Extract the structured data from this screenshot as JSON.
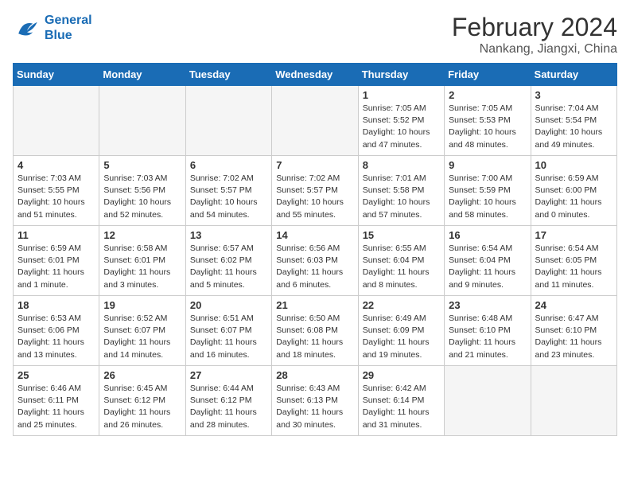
{
  "logo": {
    "line1": "General",
    "line2": "Blue"
  },
  "title": "February 2024",
  "location": "Nankang, Jiangxi, China",
  "weekdays": [
    "Sunday",
    "Monday",
    "Tuesday",
    "Wednesday",
    "Thursday",
    "Friday",
    "Saturday"
  ],
  "weeks": [
    [
      {
        "day": "",
        "info": ""
      },
      {
        "day": "",
        "info": ""
      },
      {
        "day": "",
        "info": ""
      },
      {
        "day": "",
        "info": ""
      },
      {
        "day": "1",
        "info": "Sunrise: 7:05 AM\nSunset: 5:52 PM\nDaylight: 10 hours\nand 47 minutes."
      },
      {
        "day": "2",
        "info": "Sunrise: 7:05 AM\nSunset: 5:53 PM\nDaylight: 10 hours\nand 48 minutes."
      },
      {
        "day": "3",
        "info": "Sunrise: 7:04 AM\nSunset: 5:54 PM\nDaylight: 10 hours\nand 49 minutes."
      }
    ],
    [
      {
        "day": "4",
        "info": "Sunrise: 7:03 AM\nSunset: 5:55 PM\nDaylight: 10 hours\nand 51 minutes."
      },
      {
        "day": "5",
        "info": "Sunrise: 7:03 AM\nSunset: 5:56 PM\nDaylight: 10 hours\nand 52 minutes."
      },
      {
        "day": "6",
        "info": "Sunrise: 7:02 AM\nSunset: 5:57 PM\nDaylight: 10 hours\nand 54 minutes."
      },
      {
        "day": "7",
        "info": "Sunrise: 7:02 AM\nSunset: 5:57 PM\nDaylight: 10 hours\nand 55 minutes."
      },
      {
        "day": "8",
        "info": "Sunrise: 7:01 AM\nSunset: 5:58 PM\nDaylight: 10 hours\nand 57 minutes."
      },
      {
        "day": "9",
        "info": "Sunrise: 7:00 AM\nSunset: 5:59 PM\nDaylight: 10 hours\nand 58 minutes."
      },
      {
        "day": "10",
        "info": "Sunrise: 6:59 AM\nSunset: 6:00 PM\nDaylight: 11 hours\nand 0 minutes."
      }
    ],
    [
      {
        "day": "11",
        "info": "Sunrise: 6:59 AM\nSunset: 6:01 PM\nDaylight: 11 hours\nand 1 minute."
      },
      {
        "day": "12",
        "info": "Sunrise: 6:58 AM\nSunset: 6:01 PM\nDaylight: 11 hours\nand 3 minutes."
      },
      {
        "day": "13",
        "info": "Sunrise: 6:57 AM\nSunset: 6:02 PM\nDaylight: 11 hours\nand 5 minutes."
      },
      {
        "day": "14",
        "info": "Sunrise: 6:56 AM\nSunset: 6:03 PM\nDaylight: 11 hours\nand 6 minutes."
      },
      {
        "day": "15",
        "info": "Sunrise: 6:55 AM\nSunset: 6:04 PM\nDaylight: 11 hours\nand 8 minutes."
      },
      {
        "day": "16",
        "info": "Sunrise: 6:54 AM\nSunset: 6:04 PM\nDaylight: 11 hours\nand 9 minutes."
      },
      {
        "day": "17",
        "info": "Sunrise: 6:54 AM\nSunset: 6:05 PM\nDaylight: 11 hours\nand 11 minutes."
      }
    ],
    [
      {
        "day": "18",
        "info": "Sunrise: 6:53 AM\nSunset: 6:06 PM\nDaylight: 11 hours\nand 13 minutes."
      },
      {
        "day": "19",
        "info": "Sunrise: 6:52 AM\nSunset: 6:07 PM\nDaylight: 11 hours\nand 14 minutes."
      },
      {
        "day": "20",
        "info": "Sunrise: 6:51 AM\nSunset: 6:07 PM\nDaylight: 11 hours\nand 16 minutes."
      },
      {
        "day": "21",
        "info": "Sunrise: 6:50 AM\nSunset: 6:08 PM\nDaylight: 11 hours\nand 18 minutes."
      },
      {
        "day": "22",
        "info": "Sunrise: 6:49 AM\nSunset: 6:09 PM\nDaylight: 11 hours\nand 19 minutes."
      },
      {
        "day": "23",
        "info": "Sunrise: 6:48 AM\nSunset: 6:10 PM\nDaylight: 11 hours\nand 21 minutes."
      },
      {
        "day": "24",
        "info": "Sunrise: 6:47 AM\nSunset: 6:10 PM\nDaylight: 11 hours\nand 23 minutes."
      }
    ],
    [
      {
        "day": "25",
        "info": "Sunrise: 6:46 AM\nSunset: 6:11 PM\nDaylight: 11 hours\nand 25 minutes."
      },
      {
        "day": "26",
        "info": "Sunrise: 6:45 AM\nSunset: 6:12 PM\nDaylight: 11 hours\nand 26 minutes."
      },
      {
        "day": "27",
        "info": "Sunrise: 6:44 AM\nSunset: 6:12 PM\nDaylight: 11 hours\nand 28 minutes."
      },
      {
        "day": "28",
        "info": "Sunrise: 6:43 AM\nSunset: 6:13 PM\nDaylight: 11 hours\nand 30 minutes."
      },
      {
        "day": "29",
        "info": "Sunrise: 6:42 AM\nSunset: 6:14 PM\nDaylight: 11 hours\nand 31 minutes."
      },
      {
        "day": "",
        "info": ""
      },
      {
        "day": "",
        "info": ""
      }
    ]
  ]
}
